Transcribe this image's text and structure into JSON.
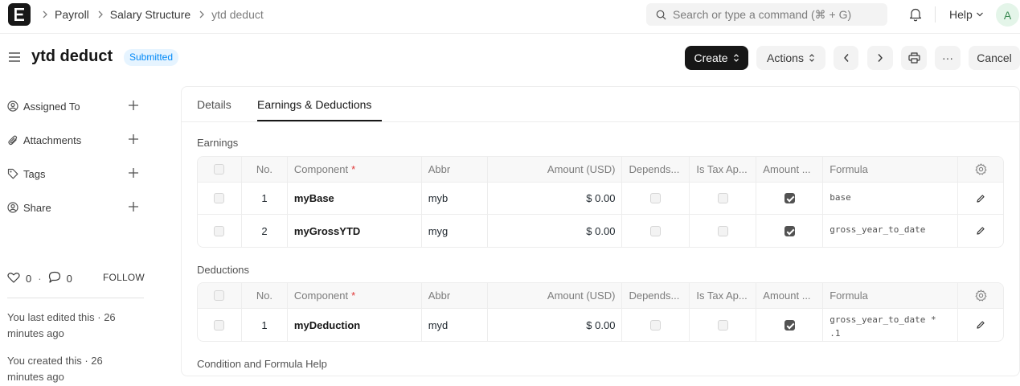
{
  "breadcrumbs": [
    "Payroll",
    "Salary Structure",
    "ytd deduct"
  ],
  "search": {
    "placeholder": "Search or type a command (⌘ + G)"
  },
  "navbar": {
    "help_label": "Help",
    "avatar_initial": "A"
  },
  "doc": {
    "title": "ytd deduct",
    "status": "Submitted"
  },
  "toolbar": {
    "create_label": "Create",
    "actions_label": "Actions",
    "more_label": "···",
    "cancel_label": "Cancel"
  },
  "sidebar": {
    "items": [
      {
        "label": "Assigned To"
      },
      {
        "label": "Attachments"
      },
      {
        "label": "Tags"
      },
      {
        "label": "Share"
      }
    ],
    "likes": "0",
    "comments": "0",
    "follow_label": "FOLLOW",
    "last_edited": "You last edited this · 26 minutes ago",
    "created": "You created this · 26 minutes ago"
  },
  "tabs": [
    "Details",
    "Earnings & Deductions"
  ],
  "columns": {
    "no": "No.",
    "component": "Component",
    "required_mark": "*",
    "abbr": "Abbr",
    "amount": "Amount (USD)",
    "depends": "Depends...",
    "is_tax": "Is Tax Ap...",
    "amount_based": "Amount ...",
    "formula": "Formula"
  },
  "earnings": {
    "label": "Earnings",
    "rows": [
      {
        "no": "1",
        "component": "myBase",
        "abbr": "myb",
        "amount": "$ 0.00",
        "depends": false,
        "is_tax": false,
        "amount_based": true,
        "formula": "base"
      },
      {
        "no": "2",
        "component": "myGrossYTD",
        "abbr": "myg",
        "amount": "$ 0.00",
        "depends": false,
        "is_tax": false,
        "amount_based": true,
        "formula": "gross_year_to_date"
      }
    ]
  },
  "deductions": {
    "label": "Deductions",
    "rows": [
      {
        "no": "1",
        "component": "myDeduction",
        "abbr": "myd",
        "amount": "$ 0.00",
        "depends": false,
        "is_tax": false,
        "amount_based": true,
        "formula": "gross_year_to_date * .1"
      }
    ]
  },
  "help_link": "Condition and Formula Help"
}
